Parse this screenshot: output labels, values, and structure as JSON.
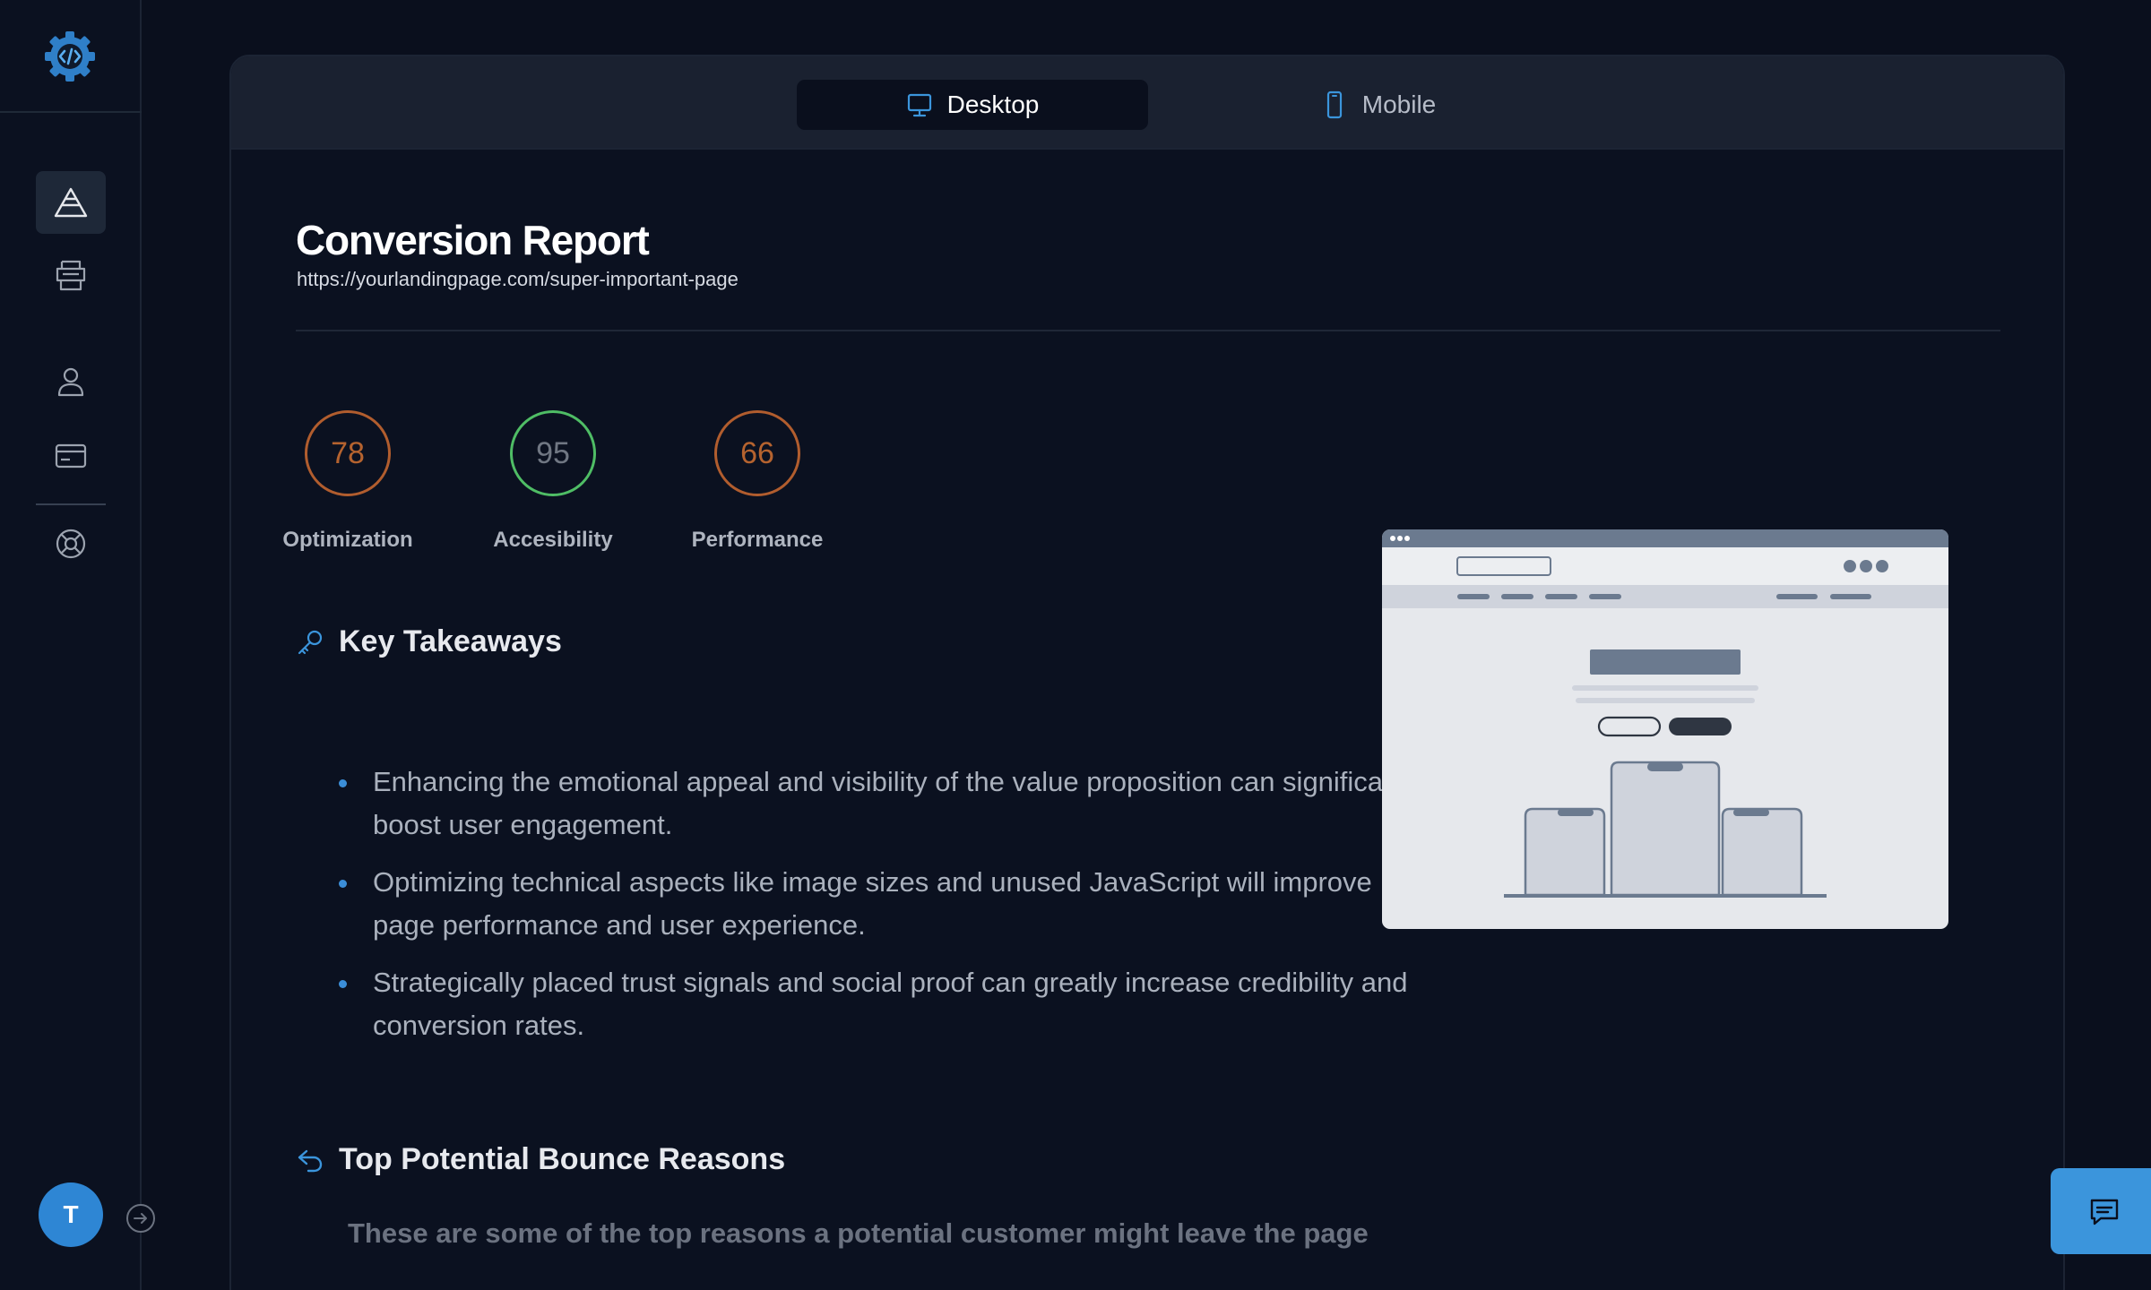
{
  "sidebar": {
    "logo_icon": "gear-code-icon",
    "items": [
      {
        "name": "pyramid",
        "icon": "triangle-icon",
        "active": true
      },
      {
        "name": "templates",
        "icon": "printer-icon",
        "active": false
      },
      {
        "name": "account",
        "icon": "user-icon",
        "active": false
      },
      {
        "name": "billing",
        "icon": "credit-card-icon",
        "active": false
      },
      {
        "name": "support",
        "icon": "lifebuoy-icon",
        "active": false
      }
    ],
    "avatar_initial": "T"
  },
  "toolbar": {
    "tabs": [
      {
        "label": "Desktop",
        "icon": "monitor-icon",
        "active": true
      },
      {
        "label": "Mobile",
        "icon": "phone-icon",
        "active": false
      }
    ]
  },
  "report": {
    "title": "Conversion Report",
    "url": "https://yourlandingpage.com/super-important-page"
  },
  "scores": [
    {
      "label": "Optimization",
      "value": "78",
      "color": "#b15d2e"
    },
    {
      "label": "Accesibility",
      "value": "95",
      "color": "#4fbd65"
    },
    {
      "label": "Performance",
      "value": "66",
      "color": "#b15d2e"
    }
  ],
  "key_takeaways": {
    "heading": "Key Takeaways",
    "items": [
      "Enhancing the emotional appeal and visibility of the value proposition can significantly boost user engagement.",
      "Optimizing technical aspects like image sizes and unused JavaScript will improve page performance and user experience.",
      "Strategically placed trust signals and social proof can greatly increase credibility and conversion rates."
    ]
  },
  "bounce": {
    "heading": "Top Potential Bounce Reasons",
    "description": "These are some of the top reasons a potential customer might leave the page"
  },
  "colors": {
    "accent": "#3b95dc",
    "background": "#0a0f1d",
    "panel": "#0b1120",
    "toolbar": "#1a2130"
  },
  "chat_icon": "chat-icon"
}
